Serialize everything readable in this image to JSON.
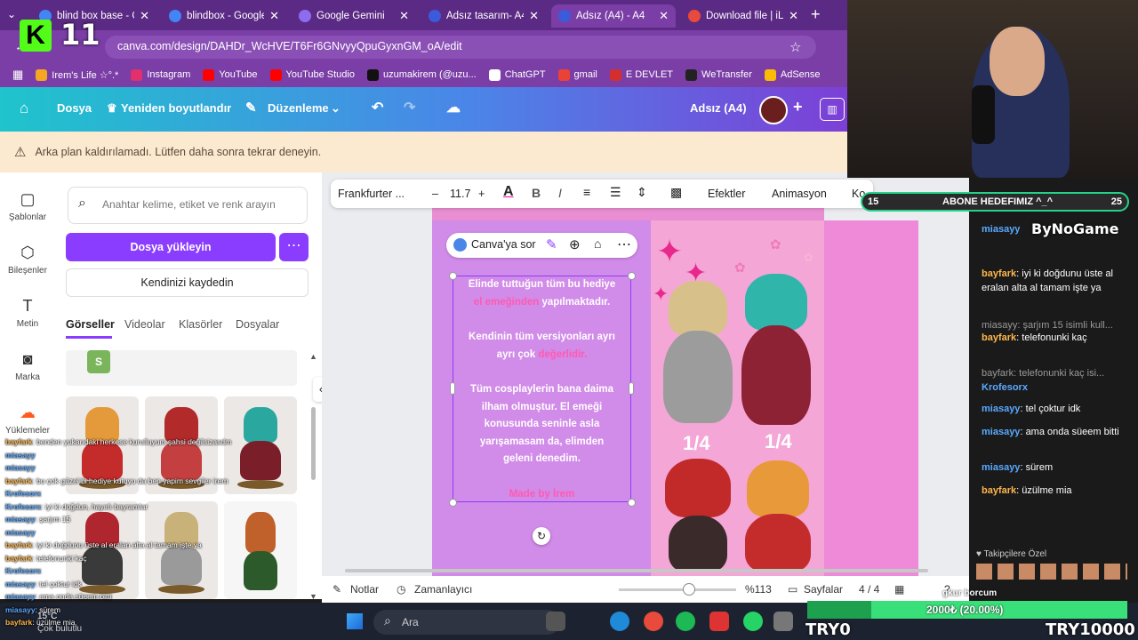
{
  "browser": {
    "tabs": [
      {
        "label": "blind box base - Go",
        "color": "#4285f4"
      },
      {
        "label": "blindbox - Google'd",
        "color": "#4285f4"
      },
      {
        "label": "Google Gemini",
        "color": "#8e6cf0"
      },
      {
        "label": "Adsız tasarım- A4 (",
        "color": "#3b5bdb"
      },
      {
        "label": "Adsız (A4) - A4",
        "color": "#3b5bdb"
      },
      {
        "label": "Download file | iLov",
        "color": "#e84a3c"
      }
    ],
    "url": "canva.com/design/DAHDr_WcHVE/T6Fr6GNvyyQpuGyxnGM_oA/edit",
    "bookmarks": [
      {
        "label": "Irem's Life ☆°.*",
        "color": "#f5a623"
      },
      {
        "label": "Instagram",
        "color": "#e1306c"
      },
      {
        "label": "YouTube",
        "color": "#ff0000"
      },
      {
        "label": "YouTube Studio",
        "color": "#ff0000"
      },
      {
        "label": "uzumakirem (@uzu...",
        "color": "#111111"
      },
      {
        "label": "ChatGPT",
        "color": "#ffffff"
      },
      {
        "label": "gmail",
        "color": "#ea4335"
      },
      {
        "label": "E DEVLET",
        "color": "#d32f2f"
      },
      {
        "label": "WeTransfer",
        "color": "#222222"
      },
      {
        "label": "AdSense",
        "color": "#fbbc05"
      }
    ]
  },
  "canva": {
    "file_label": "Dosya",
    "resize_label": "Yeniden boyutlandır",
    "edit_label": "Düzenleme",
    "doc_title": "Adsız (A4)",
    "notice": "Arka plan kaldırılamadı. Lütfen daha sonra tekrar deneyin.",
    "rail": [
      {
        "label": "Şablonlar",
        "icon": "▢"
      },
      {
        "label": "Bileşenler",
        "icon": "⬡"
      },
      {
        "label": "Metin",
        "icon": "T"
      },
      {
        "label": "Marka",
        "icon": "◙"
      },
      {
        "label": "Yüklemeler",
        "icon": "☁"
      }
    ],
    "search_placeholder": "Anahtar kelime, etiket ve renk arayın",
    "upload_label": "Dosya yükleyin",
    "record_label": "Kendinizi kaydedin",
    "panel_tabs": [
      "Görseller",
      "Videolar",
      "Klasörler",
      "Dosyalar"
    ],
    "toolbar": {
      "font": "Frankfurter ...",
      "font_size": "11.7",
      "effects": "Efektler",
      "animation": "Animasyon",
      "more": "Ko"
    },
    "ask_canva": "Canva'ya sor",
    "poem": {
      "p1a": "Elinde tuttuğun tüm bu hediye",
      "p1b_pink": "el emeğinden",
      "p1b_rest": " yapılmaktadır.",
      "p2a": "Kendinin tüm versiyonları ayrı",
      "p2b": "ayrı çok ",
      "p2b_pink": "değerlidir.",
      "p3": [
        "Tüm cosplaylerin bana daima",
        "ilham olmuştur. El emeği",
        "konusunda seninle asla",
        "yarışamasam da, elimden",
        "geleni denedim."
      ],
      "signature": "Made by İrem"
    },
    "quarters": [
      "1/4",
      "1/4"
    ],
    "status": {
      "notes": "Notlar",
      "timer": "Zamanlayıcı",
      "zoom": "%113",
      "pages": "Sayfalar",
      "page_count": "4 / 4"
    }
  },
  "taskbar": {
    "search": "Ara"
  },
  "stream": {
    "channel_number": "11",
    "goal": {
      "left": "15",
      "label": "ABONE HEDEFIMIZ ^_^",
      "right": "25"
    },
    "watermark": "ByNoGame",
    "chat": [
      {
        "user": "miasayy",
        "text": "",
        "color": "u"
      },
      {
        "user": "bayfark",
        "text": "iyi ki doğdunu üste al eralan alta al tamam işte ya",
        "color": "u2"
      },
      {
        "user": "",
        "text": "miasayy: şarjım 15 isimli kull...",
        "color": "gray"
      },
      {
        "user": "bayfark",
        "text": "telefonunki kaç",
        "color": "u2"
      },
      {
        "user": "",
        "text": "bayfark: telefonunki kaç isi...",
        "color": "gray"
      },
      {
        "user": "Krofesorx",
        "text": "",
        "color": "u"
      },
      {
        "user": "miasayy",
        "text": "tel çoktur idk",
        "color": "u"
      },
      {
        "user": "miasayy",
        "text": "ama onda süeem bitti",
        "color": "u"
      },
      {
        "user": "miasayy",
        "text": "sürem",
        "color": "u"
      },
      {
        "user": "bayfark",
        "text": "üzülme mia",
        "color": "u2"
      }
    ],
    "followers_label": "Takipçilere Özel",
    "overlay_chat": [
      {
        "user": "bayfark",
        "text": "benden yukarıdaki herkese kurulluyum şahsi değilsizasdm"
      },
      {
        "user": "miasayy",
        "text": ""
      },
      {
        "user": "miasayy",
        "text": ""
      },
      {
        "user": "bayfark",
        "text": "bu çok güzel bi hediye kutuyu da ben yapim sevgiler irem"
      },
      {
        "user": "Krofesorx",
        "text": ""
      },
      {
        "user": "Krofesorx",
        "text": "iyi ki doğdun, hayırlı bayramlar"
      },
      {
        "user": "miasayy",
        "text": "şarjım 15"
      },
      {
        "user": "miasayy",
        "text": ""
      },
      {
        "user": "bayfark",
        "text": "iyi ki doğdunu üste al eralan alta al tamam işte ya"
      },
      {
        "user": "bayfark",
        "text": "telefonunki kaç"
      },
      {
        "user": "Krofesorx",
        "text": ""
      },
      {
        "user": "miasayy",
        "text": "tel çoktur idk"
      },
      {
        "user": "miasayy",
        "text": "ama onda süeem bitti"
      },
      {
        "user": "miasayy",
        "text": "sürem"
      },
      {
        "user": "bayfark",
        "text": "üzülme mia"
      }
    ],
    "donation": "2000₺ (20.00%)",
    "borcum": "gkur borcum",
    "left_big": "TRY0",
    "right_big": "TRY10000",
    "temp": "15°C",
    "cok": "Çok bulutlu"
  }
}
